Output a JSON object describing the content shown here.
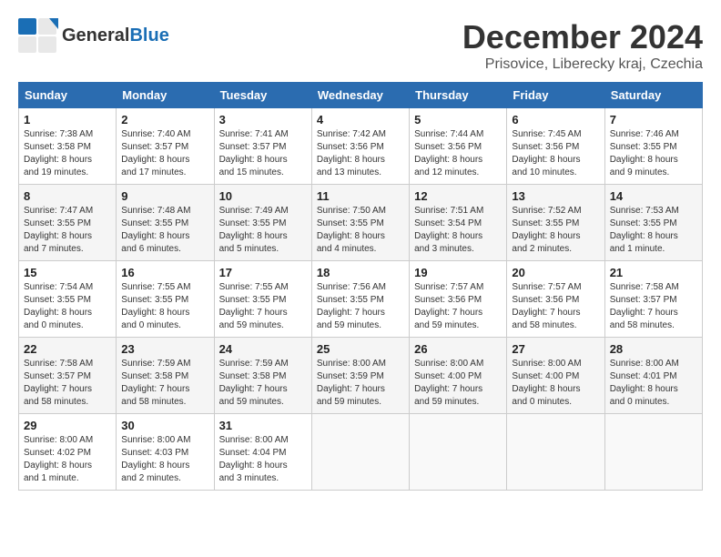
{
  "header": {
    "logo_general": "General",
    "logo_blue": "Blue",
    "title": "December 2024",
    "subtitle": "Prisovice, Liberecky kraj, Czechia"
  },
  "weekdays": [
    "Sunday",
    "Monday",
    "Tuesday",
    "Wednesday",
    "Thursday",
    "Friday",
    "Saturday"
  ],
  "weeks": [
    [
      {
        "day": "1",
        "info": "Sunrise: 7:38 AM\nSunset: 3:58 PM\nDaylight: 8 hours\nand 19 minutes."
      },
      {
        "day": "2",
        "info": "Sunrise: 7:40 AM\nSunset: 3:57 PM\nDaylight: 8 hours\nand 17 minutes."
      },
      {
        "day": "3",
        "info": "Sunrise: 7:41 AM\nSunset: 3:57 PM\nDaylight: 8 hours\nand 15 minutes."
      },
      {
        "day": "4",
        "info": "Sunrise: 7:42 AM\nSunset: 3:56 PM\nDaylight: 8 hours\nand 13 minutes."
      },
      {
        "day": "5",
        "info": "Sunrise: 7:44 AM\nSunset: 3:56 PM\nDaylight: 8 hours\nand 12 minutes."
      },
      {
        "day": "6",
        "info": "Sunrise: 7:45 AM\nSunset: 3:56 PM\nDaylight: 8 hours\nand 10 minutes."
      },
      {
        "day": "7",
        "info": "Sunrise: 7:46 AM\nSunset: 3:55 PM\nDaylight: 8 hours\nand 9 minutes."
      }
    ],
    [
      {
        "day": "8",
        "info": "Sunrise: 7:47 AM\nSunset: 3:55 PM\nDaylight: 8 hours\nand 7 minutes."
      },
      {
        "day": "9",
        "info": "Sunrise: 7:48 AM\nSunset: 3:55 PM\nDaylight: 8 hours\nand 6 minutes."
      },
      {
        "day": "10",
        "info": "Sunrise: 7:49 AM\nSunset: 3:55 PM\nDaylight: 8 hours\nand 5 minutes."
      },
      {
        "day": "11",
        "info": "Sunrise: 7:50 AM\nSunset: 3:55 PM\nDaylight: 8 hours\nand 4 minutes."
      },
      {
        "day": "12",
        "info": "Sunrise: 7:51 AM\nSunset: 3:54 PM\nDaylight: 8 hours\nand 3 minutes."
      },
      {
        "day": "13",
        "info": "Sunrise: 7:52 AM\nSunset: 3:55 PM\nDaylight: 8 hours\nand 2 minutes."
      },
      {
        "day": "14",
        "info": "Sunrise: 7:53 AM\nSunset: 3:55 PM\nDaylight: 8 hours\nand 1 minute."
      }
    ],
    [
      {
        "day": "15",
        "info": "Sunrise: 7:54 AM\nSunset: 3:55 PM\nDaylight: 8 hours\nand 0 minutes."
      },
      {
        "day": "16",
        "info": "Sunrise: 7:55 AM\nSunset: 3:55 PM\nDaylight: 8 hours\nand 0 minutes."
      },
      {
        "day": "17",
        "info": "Sunrise: 7:55 AM\nSunset: 3:55 PM\nDaylight: 7 hours\nand 59 minutes."
      },
      {
        "day": "18",
        "info": "Sunrise: 7:56 AM\nSunset: 3:55 PM\nDaylight: 7 hours\nand 59 minutes."
      },
      {
        "day": "19",
        "info": "Sunrise: 7:57 AM\nSunset: 3:56 PM\nDaylight: 7 hours\nand 59 minutes."
      },
      {
        "day": "20",
        "info": "Sunrise: 7:57 AM\nSunset: 3:56 PM\nDaylight: 7 hours\nand 58 minutes."
      },
      {
        "day": "21",
        "info": "Sunrise: 7:58 AM\nSunset: 3:57 PM\nDaylight: 7 hours\nand 58 minutes."
      }
    ],
    [
      {
        "day": "22",
        "info": "Sunrise: 7:58 AM\nSunset: 3:57 PM\nDaylight: 7 hours\nand 58 minutes."
      },
      {
        "day": "23",
        "info": "Sunrise: 7:59 AM\nSunset: 3:58 PM\nDaylight: 7 hours\nand 58 minutes."
      },
      {
        "day": "24",
        "info": "Sunrise: 7:59 AM\nSunset: 3:58 PM\nDaylight: 7 hours\nand 59 minutes."
      },
      {
        "day": "25",
        "info": "Sunrise: 8:00 AM\nSunset: 3:59 PM\nDaylight: 7 hours\nand 59 minutes."
      },
      {
        "day": "26",
        "info": "Sunrise: 8:00 AM\nSunset: 4:00 PM\nDaylight: 7 hours\nand 59 minutes."
      },
      {
        "day": "27",
        "info": "Sunrise: 8:00 AM\nSunset: 4:00 PM\nDaylight: 8 hours\nand 0 minutes."
      },
      {
        "day": "28",
        "info": "Sunrise: 8:00 AM\nSunset: 4:01 PM\nDaylight: 8 hours\nand 0 minutes."
      }
    ],
    [
      {
        "day": "29",
        "info": "Sunrise: 8:00 AM\nSunset: 4:02 PM\nDaylight: 8 hours\nand 1 minute."
      },
      {
        "day": "30",
        "info": "Sunrise: 8:00 AM\nSunset: 4:03 PM\nDaylight: 8 hours\nand 2 minutes."
      },
      {
        "day": "31",
        "info": "Sunrise: 8:00 AM\nSunset: 4:04 PM\nDaylight: 8 hours\nand 3 minutes."
      },
      {
        "day": "",
        "info": ""
      },
      {
        "day": "",
        "info": ""
      },
      {
        "day": "",
        "info": ""
      },
      {
        "day": "",
        "info": ""
      }
    ]
  ]
}
